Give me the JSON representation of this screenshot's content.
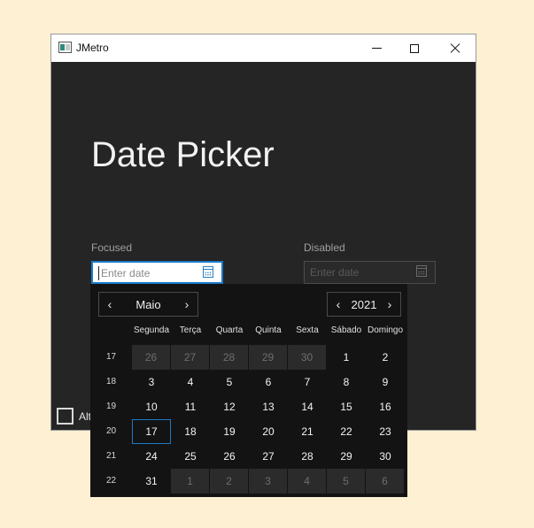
{
  "window": {
    "title": "JMetro"
  },
  "page": {
    "title": "Date Picker"
  },
  "focused": {
    "label": "Focused",
    "placeholder": "Enter date"
  },
  "disabled": {
    "label": "Disabled",
    "placeholder": "Enter date"
  },
  "checkbox": {
    "label": "Alt"
  },
  "calendar": {
    "month": "Maio",
    "year": "2021",
    "prev_glyph": "‹",
    "next_glyph": "›",
    "day_names": [
      "Segunda",
      "Terça",
      "Quarta",
      "Quinta",
      "Sexta",
      "Sábado",
      "Domingo"
    ],
    "week_numbers": [
      "17",
      "18",
      "19",
      "20",
      "21",
      "22"
    ],
    "weeks": [
      [
        "26",
        "27",
        "28",
        "29",
        "30",
        "1",
        "2"
      ],
      [
        "3",
        "4",
        "5",
        "6",
        "7",
        "8",
        "9"
      ],
      [
        "10",
        "11",
        "12",
        "13",
        "14",
        "15",
        "16"
      ],
      [
        "17",
        "18",
        "19",
        "20",
        "21",
        "22",
        "23"
      ],
      [
        "24",
        "25",
        "26",
        "27",
        "28",
        "29",
        "30"
      ],
      [
        "31",
        "1",
        "2",
        "3",
        "4",
        "5",
        "6"
      ]
    ],
    "selected_day": "17"
  }
}
